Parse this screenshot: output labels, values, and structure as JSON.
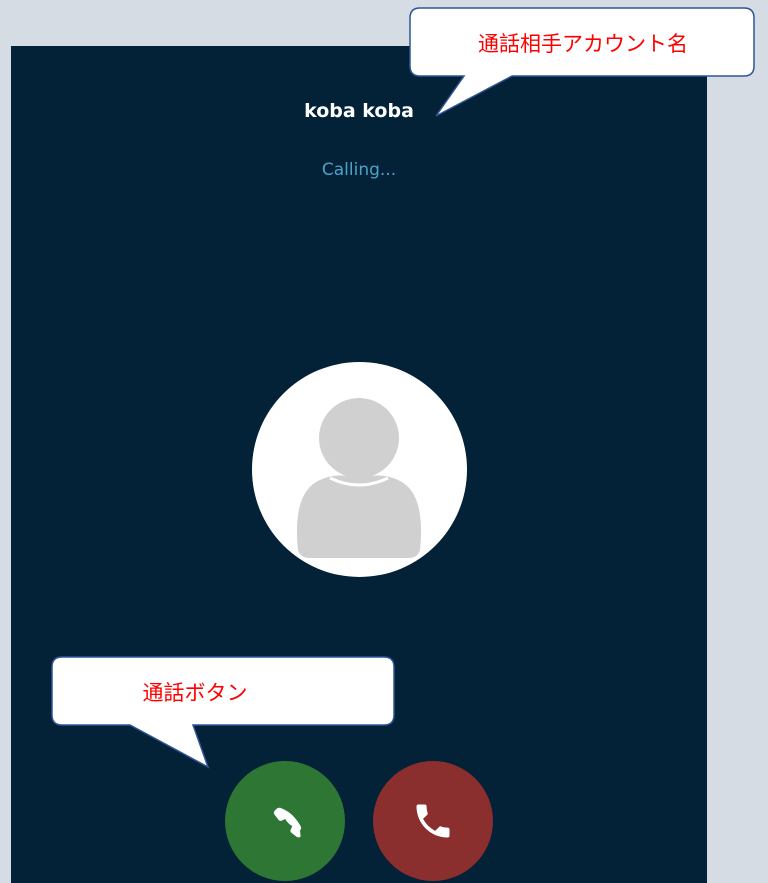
{
  "call": {
    "caller_name": "koba koba",
    "status": "Calling..."
  },
  "buttons": {
    "answer_icon": "phone-answer-icon",
    "hangup_icon": "phone-hangup-icon"
  },
  "annotations": {
    "account_name_callout": "通話相手アカウント名",
    "call_button_callout": "通話ボタン"
  },
  "colors": {
    "background": "#d6dce4",
    "panel": "#032137",
    "status_text": "#4ba3c8",
    "answer_button": "#2e7634",
    "hangup_button": "#8a2e2e",
    "callout_text": "#ff0000",
    "callout_border": "#2f5597"
  }
}
